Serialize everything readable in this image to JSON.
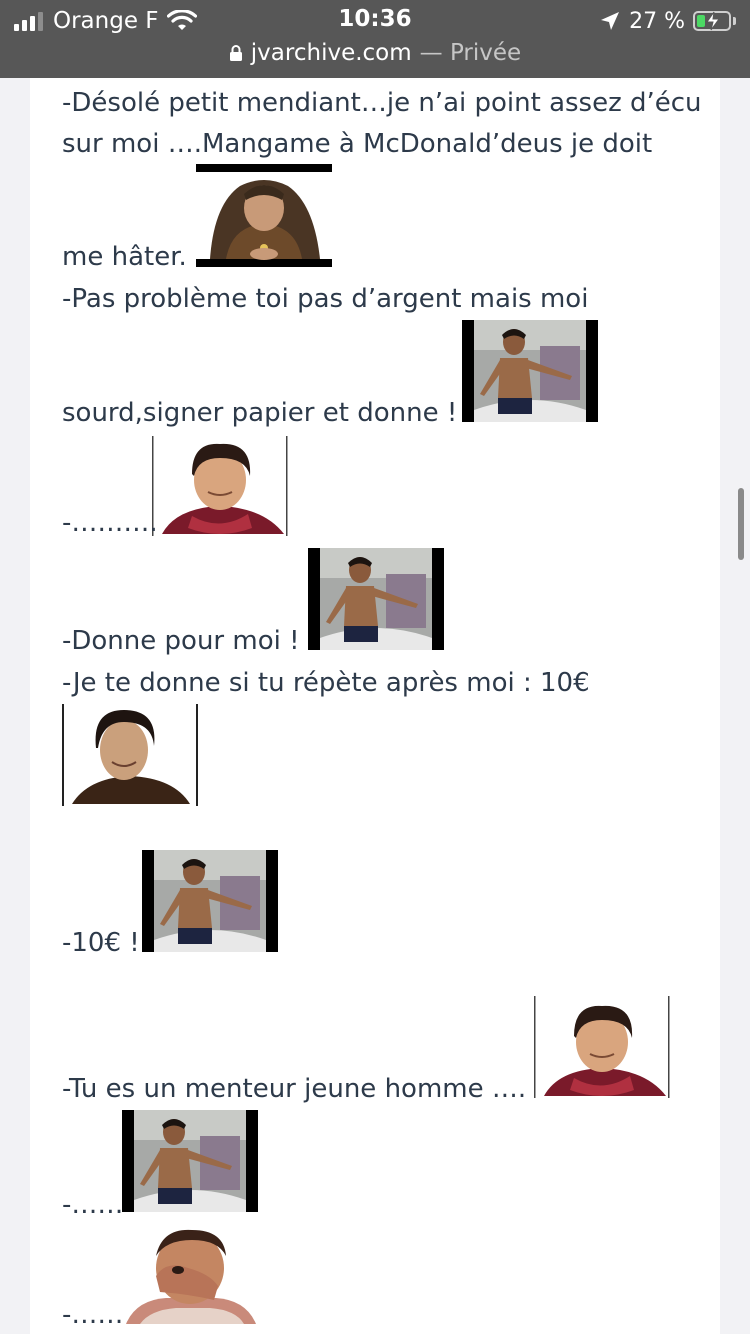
{
  "status_bar": {
    "carrier": "Orange F",
    "time": "10:36",
    "battery_percent": "27 %",
    "battery_level": 0.27,
    "url_domain": "jvarchive.com",
    "url_suffix": "— Privée",
    "icons": [
      "signal-icon",
      "wifi-icon",
      "location-arrow-icon",
      "battery-charging-icon",
      "lock-icon"
    ]
  },
  "post": {
    "lines": [
      "-Désolé petit mendiant…je n’ai point assez d’écu",
      "sur moi ….Mangame à McDonald’deus je doit",
      "me hâter.",
      "-Pas problème toi pas d’argent mais moi",
      "sourd,signer papier et donne !",
      "-……….",
      "-Donne pour moi !",
      "-Je te donne si tu répète après moi : 10€",
      "-10€ !",
      "-Tu es un menteur jeune homme ….",
      "-……",
      "-……"
    ],
    "stickers": [
      "sticker-old-man-hood",
      "sticker-boy-shirtless",
      "sticker-man-red-scarf",
      "sticker-boy-shirtless",
      "sticker-man-brown-jacket",
      "sticker-boy-shirtless",
      "sticker-man-red-scarf",
      "sticker-boy-shirtless",
      "sticker-man-facepalm"
    ]
  },
  "colors": {
    "status_bar_bg": "#575757",
    "page_bg": "#f2f2f5",
    "card_bg": "#ffffff",
    "text": "#2d3a4a",
    "battery_green": "#4cd964"
  }
}
